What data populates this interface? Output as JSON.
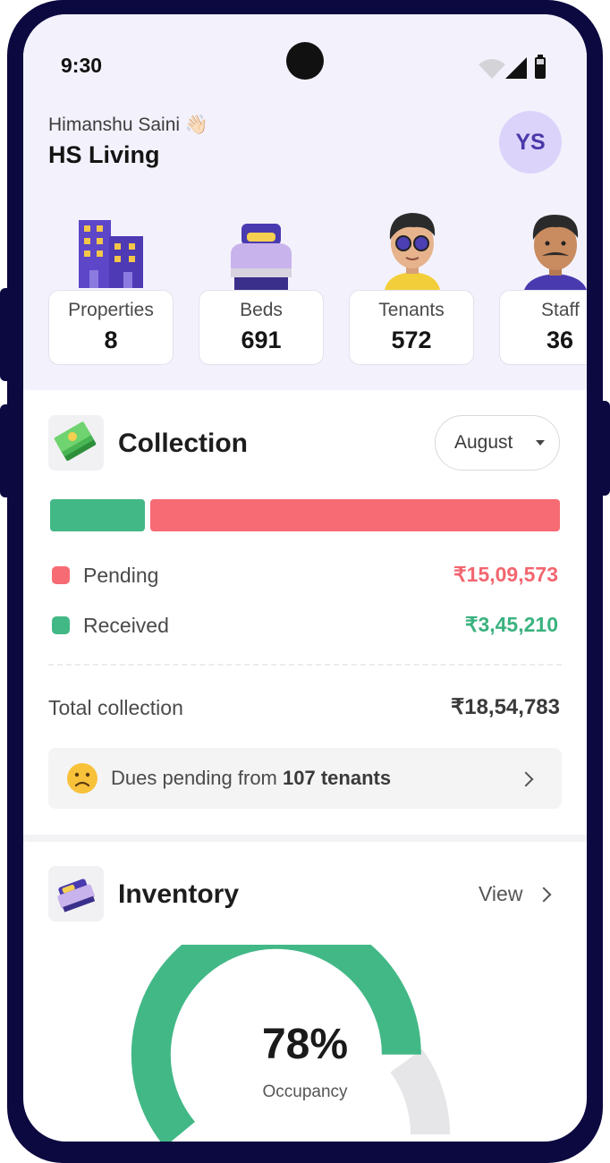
{
  "status_bar": {
    "time": "9:30"
  },
  "header": {
    "user_name": "Himanshu Saini",
    "wave_emoji": "👋🏻",
    "business_name": "HS Living",
    "avatar_initials": "YS"
  },
  "stats": [
    {
      "label": "Properties",
      "value": "8"
    },
    {
      "label": "Beds",
      "value": "691"
    },
    {
      "label": "Tenants",
      "value": "572"
    },
    {
      "label": "Staff",
      "value": "36"
    }
  ],
  "collection": {
    "title": "Collection",
    "month": "August",
    "received_fraction": 0.186,
    "pending": {
      "label": "Pending",
      "amount": "₹15,09,573",
      "color": "#f66b74"
    },
    "received": {
      "label": "Received",
      "amount": "₹3,45,210",
      "color": "#42b886"
    },
    "total_label": "Total collection",
    "total_amount": "₹18,54,783",
    "dues": {
      "prefix": "Dues pending from",
      "highlight": "107 tenants"
    }
  },
  "inventory": {
    "title": "Inventory",
    "view_label": "View",
    "occupancy_percent": 78,
    "occupancy_text": "78%",
    "occupancy_label": "Occupancy",
    "filled_color": "#42b886",
    "empty_color": "#e6e6e8"
  },
  "icons": {
    "wave": "waving-hand-icon",
    "properties": "buildings-illustration",
    "beds": "bed-illustration",
    "tenants": "tenant-avatar-illustration",
    "staff": "staff-avatar-illustration",
    "collection": "cash-stack-icon",
    "inventory": "bed-icon",
    "dues": "sad-face-icon",
    "month_dropdown": "caret-down-icon",
    "dues_arrow": "chevron-right-icon",
    "view_arrow": "chevron-right-icon"
  }
}
